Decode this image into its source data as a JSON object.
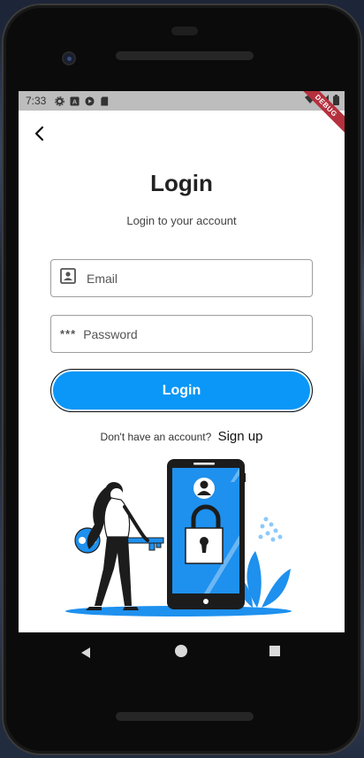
{
  "status": {
    "time": "7:33",
    "debug_label": "DEBUG"
  },
  "header": {
    "title": "Login",
    "subtitle": "Login to your account"
  },
  "form": {
    "email_placeholder": "Email",
    "password_placeholder": "Password",
    "password_icon_text": "***",
    "login_label": "Login"
  },
  "signup": {
    "prompt": "Don't have an account?",
    "link_label": "Sign up"
  },
  "colors": {
    "accent": "#0a97f7",
    "status_bar": "#bdbdbd",
    "debug_banner": "#b5303d"
  },
  "icons": [
    "back-arrow-icon",
    "settings-icon",
    "account-box-icon",
    "play-icon",
    "sd-card-icon",
    "wifi-icon",
    "signal-icon",
    "battery-icon",
    "user-id-icon",
    "nav-back-icon",
    "nav-home-icon",
    "nav-recent-icon"
  ]
}
